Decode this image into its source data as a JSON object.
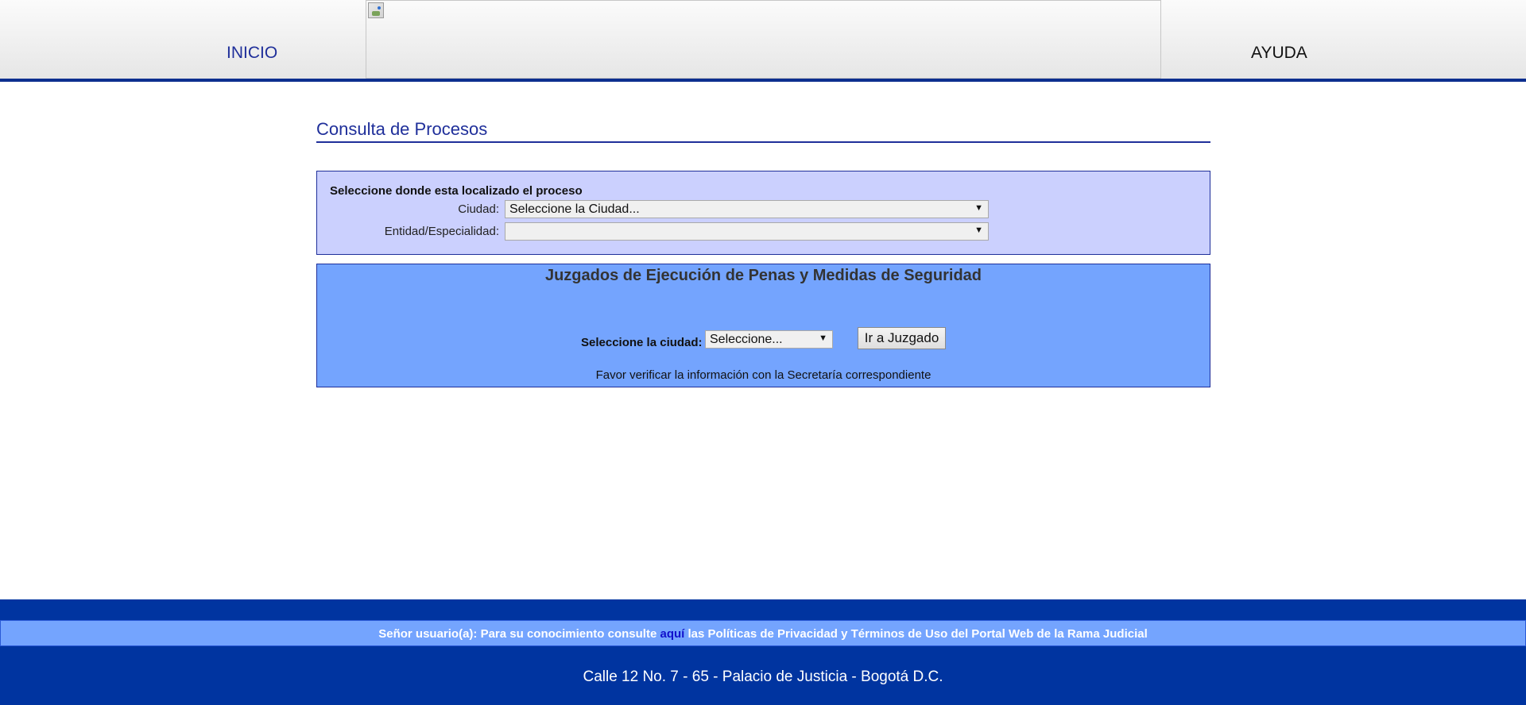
{
  "header": {
    "nav_inicio": "INICIO",
    "nav_ayuda": "AYUDA",
    "banner_icon": "broken-image-icon"
  },
  "main": {
    "page_title": "Consulta de Procesos",
    "search_panel": {
      "heading": "Seleccione donde esta localizado el proceso",
      "ciudad_label": "Ciudad:",
      "ciudad_value": "Seleccione la Ciudad...",
      "entidad_label": "Entidad/Especialidad:",
      "entidad_value": ""
    },
    "juzgados_panel": {
      "title": "Juzgados de Ejecución de Penas y Medidas de Seguridad",
      "ciudad_label": "Seleccione la ciudad:",
      "ciudad_value": "Seleccione...",
      "button_label": "Ir a Juzgado",
      "note": "Favor verificar la información con la Secretaría correspondiente"
    }
  },
  "footer": {
    "privacy_prefix": "Señor usuario(a): Para su conocimiento consulte ",
    "privacy_link": "aquí",
    "privacy_suffix": " las Políticas de Privacidad y Términos de Uso del Portal Web de la Rama Judicial",
    "address": "Calle 12 No. 7 - 65 - Palacio de Justicia - Bogotá D.C."
  },
  "colors": {
    "nav_border": "#0d2f8f",
    "title_blue": "#1f2f9a",
    "search_panel_bg": "#cbd0fe",
    "juzgados_panel_bg": "#74a4fe",
    "footer_bg": "#0034a0"
  }
}
